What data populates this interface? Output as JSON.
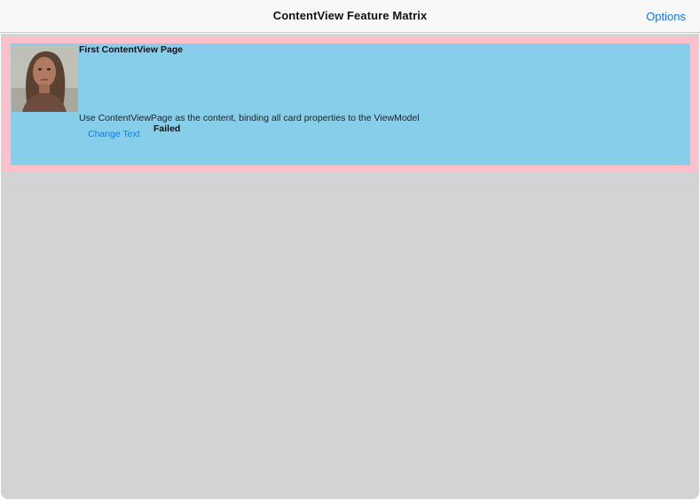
{
  "navbar": {
    "title": "ContentView Feature Matrix",
    "options_label": "Options"
  },
  "colors": {
    "content_background": "#d3d3d3",
    "card_border": "#ffc0cb",
    "card_background": "#87ceeb",
    "link_blue": "#0a7aff"
  },
  "card": {
    "image_icon": "person-photo",
    "title": "First ContentView Page",
    "description": "Use ContentViewPage as the content, binding all card properties to the ViewModel",
    "button_label": "Change Text",
    "status": "Failed"
  }
}
